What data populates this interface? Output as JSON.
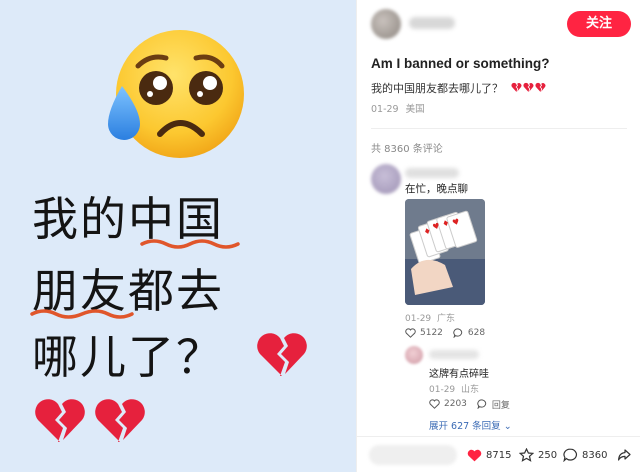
{
  "image_post": {
    "caption_line1": "我的中国",
    "caption_line2": "朋友都去",
    "caption_line3": "哪儿了？"
  },
  "header": {
    "follow_label": "关注"
  },
  "post": {
    "title": "Am I banned or something?",
    "body": "我的中国朋友都去哪儿了？",
    "date": "01-29",
    "location": "美国"
  },
  "comments": {
    "count_label": "共 8360 条评论",
    "top": {
      "text": "在忙，晚点聊",
      "date": "01-29",
      "location": "广东",
      "likes": "5122",
      "replies": "628"
    },
    "reply": {
      "text": "这牌有点碎哇",
      "date": "01-29",
      "location": "山东",
      "likes": "2203",
      "reply_label": "回复"
    },
    "expand_label": "展开 627 条回复"
  },
  "bottom_bar": {
    "likes": "8715",
    "stars": "250",
    "comments": "8360"
  },
  "colors": {
    "accent": "#ff2442",
    "link": "#3b6bb5",
    "image_bg": "#ddeaf9",
    "heart": "#e6213d"
  }
}
